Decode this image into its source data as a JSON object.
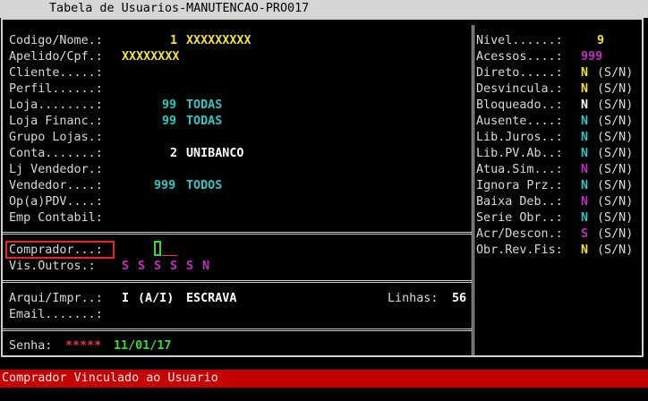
{
  "window": {
    "title": "Tabela de Usuarios-MANUTENCAO-PRO017"
  },
  "left": {
    "codigo": {
      "label": "Codigo/Nome.:",
      "num": "1",
      "name": "XXXXXXXXX"
    },
    "apelido": {
      "label": "Apelido/Cpf.:",
      "value": "XXXXXXXX"
    },
    "cliente": {
      "label": "Cliente.....:"
    },
    "perfil": {
      "label": "Perfil......:"
    },
    "loja": {
      "label": "Loja........:",
      "num": "99",
      "name": "TODAS"
    },
    "loja_financ": {
      "label": "Loja Financ.:",
      "num": "99",
      "name": "TODAS"
    },
    "grupo_lojas": {
      "label": "Grupo Lojas.:"
    },
    "conta": {
      "label": "Conta.......:",
      "num": "2",
      "name": "UNIBANCO"
    },
    "lj_vendedor": {
      "label": "Lj Vendedor.:"
    },
    "vendedor": {
      "label": "Vendedor....:",
      "num": "999",
      "name": "TODOS"
    },
    "opa_pdv": {
      "label": "Op(a)PDV....:"
    },
    "emp_contabil": {
      "label": "Emp Contabil:"
    },
    "comprador": {
      "label": "Comprador...:"
    },
    "vis_outros": {
      "label": "Vis.Outros.:",
      "values": [
        "S",
        "S",
        "S",
        "S",
        "S",
        "N"
      ]
    },
    "arqui": {
      "label": "Arqui/Impr..:",
      "value": "I",
      "hint": "(A/I)",
      "type": "ESCRAVA"
    },
    "linhas": {
      "label": "Linhas:",
      "value": "56"
    },
    "email": {
      "label": "Email.......:"
    },
    "senha": {
      "label": "Senha:",
      "mask": "*****",
      "date": "11/01/17"
    }
  },
  "right": {
    "nivel": {
      "label": "Nivel......:",
      "value": "9"
    },
    "acessos": {
      "label": "Acessos....:",
      "value": "999"
    },
    "flags": [
      {
        "label": "Direto.....:",
        "value": "N",
        "hint": "(S/N)",
        "color": "#f2e33a"
      },
      {
        "label": "Desvincula.:",
        "value": "N",
        "hint": "(S/N)",
        "color": "#f2e33a"
      },
      {
        "label": "Bloqueado..:",
        "value": "N",
        "hint": "(S/N)",
        "color": "#ffffff"
      },
      {
        "label": "Ausente....:",
        "value": "N",
        "hint": "(S/N)",
        "color": "#31c4c4"
      },
      {
        "label": "Lib.Juros..:",
        "value": "N",
        "hint": "(S/N)",
        "color": "#31c4c4"
      },
      {
        "label": "Lib.PV.Ab..:",
        "value": "N",
        "hint": "(S/N)",
        "color": "#31c4c4"
      },
      {
        "label": "Atua.Sim...:",
        "value": "N",
        "hint": "(S/N)",
        "color": "#c030c0"
      },
      {
        "label": "Ignora Prz.:",
        "value": "N",
        "hint": "(S/N)",
        "color": "#31c4c4"
      },
      {
        "label": "Baixa Deb..:",
        "value": "N",
        "hint": "(S/N)",
        "color": "#c030c0"
      },
      {
        "label": "Serie Obr..:",
        "value": "N",
        "hint": "(S/N)",
        "color": "#31c4c4"
      },
      {
        "label": "Acr/Descon.:",
        "value": "S",
        "hint": "(S/N)",
        "color": "#c030c0"
      },
      {
        "label": "Obr.Rev.Fis:",
        "value": "N",
        "hint": "(S/N)",
        "color": "#f2e33a"
      }
    ]
  },
  "status": {
    "message": "Comprador Vinculado ao Usuario"
  }
}
